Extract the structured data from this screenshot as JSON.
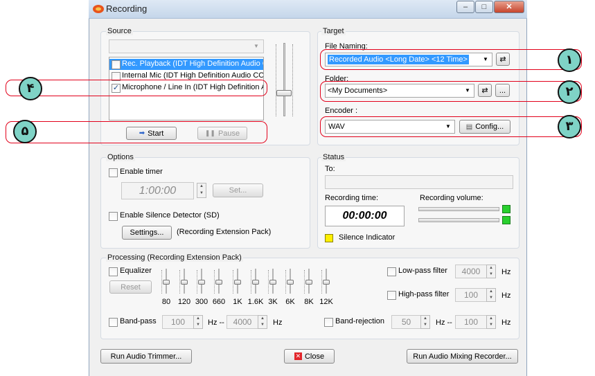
{
  "window": {
    "title": "Recording",
    "minimize": "–",
    "maximize": "□",
    "close": "✕"
  },
  "icons": {
    "app": "app-icon",
    "swap": "swap-icon",
    "start": "play-arrow-icon",
    "pause": "pause-icon",
    "close": "close-x-icon",
    "config": "document-icon"
  },
  "source": {
    "title": "Source",
    "devices": [
      {
        "label": "Rec. Playback (IDT High Definition Audio C",
        "checked": false,
        "selected": true
      },
      {
        "label": "Internal Mic (IDT High Definition Audio COD",
        "checked": false,
        "selected": false
      },
      {
        "label": "Microphone / Line In (IDT High Definition A",
        "checked": true,
        "selected": false
      }
    ],
    "start": "Start",
    "pause": "Pause"
  },
  "target": {
    "title": "Target",
    "file_naming_label": "File Naming:",
    "file_naming_value": "Recorded Audio <Long Date> <12 Time>",
    "folder_label": "Folder:",
    "folder_value": "<My Documents>",
    "browse": "...",
    "encoder_label": "Encoder :",
    "encoder_value": "WAV",
    "config": "Config..."
  },
  "options": {
    "title": "Options",
    "enable_timer": "Enable timer",
    "timer_value": "1:00:00",
    "set": "Set...",
    "enable_sd": "Enable Silence Detector (SD)",
    "settings": "Settings...",
    "extension_note": "(Recording Extension Pack)"
  },
  "status": {
    "title": "Status",
    "to_label": "To:",
    "recording_time_label": "Recording time:",
    "recording_time": "00:00:00",
    "recording_volume_label": "Recording volume:",
    "silence_indicator": "Silence Indicator"
  },
  "processing": {
    "title": "Processing (Recording Extension Pack)",
    "equalizer": "Equalizer",
    "reset": "Reset",
    "bands": [
      "80",
      "120",
      "300",
      "660",
      "1K",
      "1.6K",
      "3K",
      "6K",
      "8K",
      "12K"
    ],
    "low_pass": "Low-pass filter",
    "low_pass_value": "4000",
    "high_pass": "High-pass filter",
    "high_pass_value": "100",
    "hz": "Hz",
    "band_pass": "Band-pass",
    "band_pass_from": "100",
    "band_pass_to": "4000",
    "hz_dash": "Hz --",
    "band_rejection": "Band-rejection",
    "band_rejection_from": "50",
    "band_rejection_to": "100"
  },
  "footer": {
    "run_trimmer": "Run Audio Trimmer...",
    "close": "Close",
    "run_mixing": "Run Audio Mixing Recorder..."
  },
  "annotations": {
    "b1": "١",
    "b2": "٢",
    "b3": "٣",
    "b4": "۴",
    "b5": "۵"
  },
  "colors": {
    "annotation_red": "#e2001a",
    "badge_fill": "#7fd3c6",
    "selection_blue": "#3399ff",
    "level_green": "#29d02e",
    "silence_yellow": "#ffef00"
  }
}
